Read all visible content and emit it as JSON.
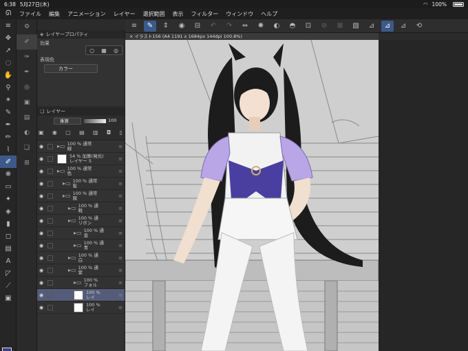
{
  "status": {
    "time": "6:38",
    "date": "5月27日(木)",
    "battery": "100%"
  },
  "menu": [
    "ファイル",
    "編集",
    "アニメーション",
    "レイヤー",
    "選択範囲",
    "表示",
    "フィルター",
    "ウィンドウ",
    "ヘルプ"
  ],
  "layer_property": {
    "title": "レイヤープロパティ",
    "effect_label": "効果",
    "expression_label": "表現色",
    "expression_value": "カラー"
  },
  "layer_panel": {
    "title": "レイヤー",
    "blend_mode": "乗算",
    "opacity": "100",
    "layers": [
      {
        "pct": "100 %",
        "mode": "通常",
        "name": "線",
        "type": "folder",
        "indent": 0
      },
      {
        "pct": "54 %",
        "mode": "加算(発光)",
        "name": "レイヤー 5",
        "type": "raster",
        "indent": 0
      },
      {
        "pct": "100 %",
        "mode": "通常",
        "name": "色",
        "type": "folder",
        "indent": 0
      },
      {
        "pct": "100 %",
        "mode": "通常",
        "name": "髪",
        "type": "folder",
        "indent": 1
      },
      {
        "pct": "100 %",
        "mode": "通常",
        "name": "服",
        "type": "folder",
        "indent": 1
      },
      {
        "pct": "100 %",
        "mode": "通",
        "name": "靴",
        "type": "folder",
        "indent": 2
      },
      {
        "pct": "100 %",
        "mode": "通",
        "name": "リボン",
        "type": "folder",
        "indent": 2
      },
      {
        "pct": "100 %",
        "mode": "通",
        "name": "金",
        "type": "folder",
        "indent": 3
      },
      {
        "pct": "100 %",
        "mode": "通",
        "name": "青",
        "type": "folder",
        "indent": 3
      },
      {
        "pct": "100 %",
        "mode": "通",
        "name": "白",
        "type": "folder",
        "indent": 2
      },
      {
        "pct": "100 %",
        "mode": "通",
        "name": "紫",
        "type": "folder",
        "indent": 2
      },
      {
        "pct": "100 %",
        "mode": "",
        "name": "フォル",
        "type": "folder",
        "indent": 3
      },
      {
        "pct": "100 %",
        "mode": "",
        "name": "レイ",
        "type": "raster",
        "indent": 3,
        "selected": true
      },
      {
        "pct": "100 %",
        "mode": "",
        "name": "レイ",
        "type": "raster",
        "indent": 3
      }
    ]
  },
  "document": {
    "tab": "イラスト156 (A4 1191 x 1684px 144dpi 100.8%)"
  },
  "colors": {
    "accent": "#3b5a8a",
    "foreground": "#3b3f8a",
    "background": "#9a8ccc"
  }
}
